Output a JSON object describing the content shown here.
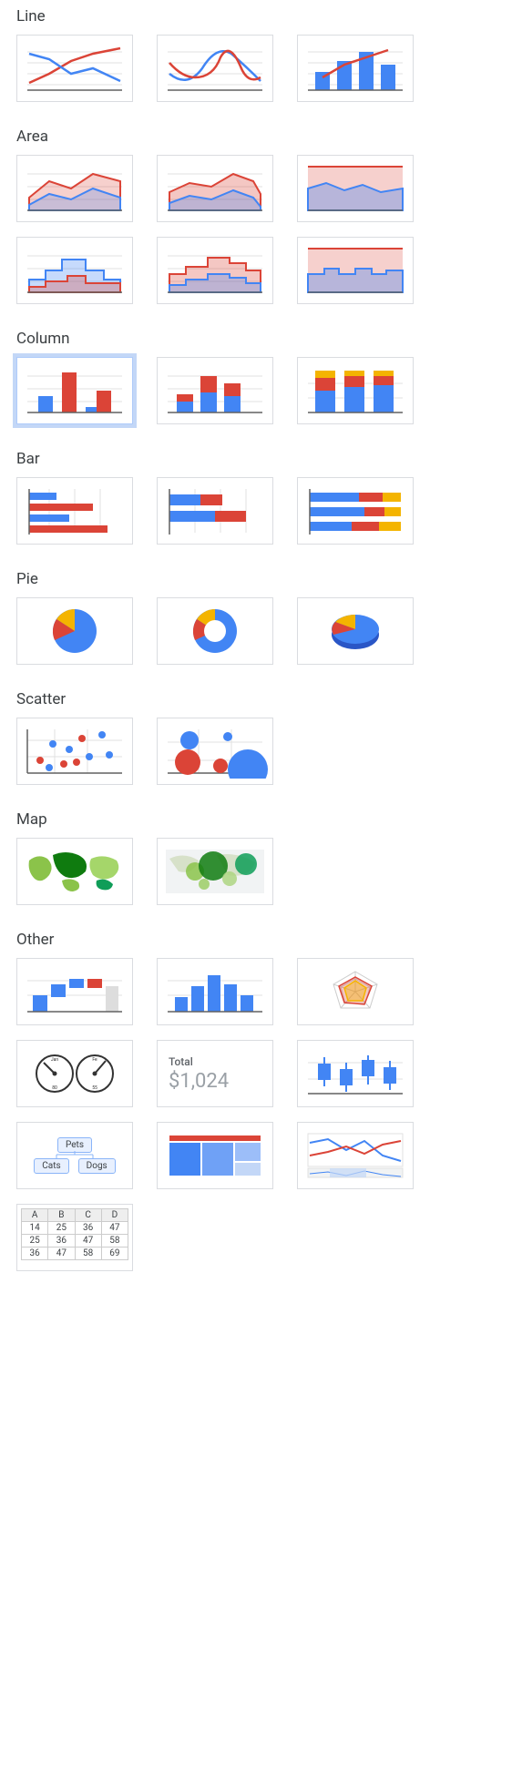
{
  "sections": {
    "line": "Line",
    "area": "Area",
    "column": "Column",
    "bar": "Bar",
    "pie": "Pie",
    "scatter": "Scatter",
    "map": "Map",
    "other": "Other"
  },
  "scorecard": {
    "label": "Total",
    "value": "$1,024"
  },
  "orgchart": {
    "root": "Pets",
    "children": [
      "Cats",
      "Dogs"
    ]
  },
  "datatable": {
    "headers": [
      "A",
      "B",
      "C",
      "D"
    ],
    "rows": [
      [
        "14",
        "25",
        "36",
        "47"
      ],
      [
        "25",
        "36",
        "47",
        "58"
      ],
      [
        "36",
        "47",
        "58",
        "69"
      ]
    ]
  },
  "colors": {
    "blue": "#4285f4",
    "red": "#db4437",
    "orange": "#f4b400",
    "green": "#0f9d58",
    "lightBlue": "#c3d7f7",
    "gridline": "#e0e0e0",
    "axis": "#616161"
  }
}
